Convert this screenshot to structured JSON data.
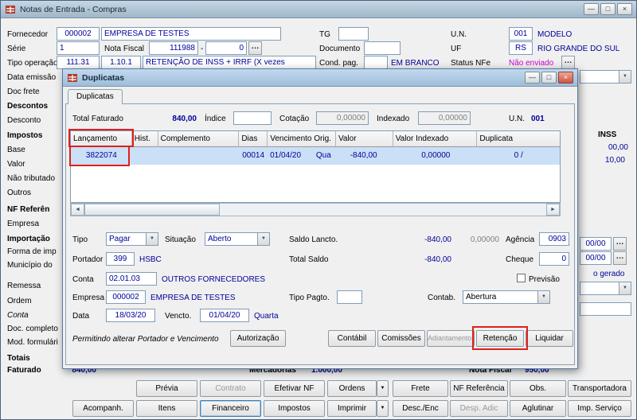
{
  "icons": {
    "minimize": "—",
    "maximize": "□",
    "close": "×",
    "dropdown": "▼",
    "dots": "…",
    "scroll_left": "◄",
    "scroll_right": "►",
    "dash": "-"
  },
  "window": {
    "title": "Notas de Entrada - Compras"
  },
  "form": {
    "fornecedor_label": "Fornecedor",
    "fornecedor_code": "000002",
    "fornecedor_name": "EMPRESA DE TESTES",
    "tg_label": "TG",
    "un_label": "U.N.",
    "un_code": "001",
    "un_name": "MODELO",
    "serie_label": "Série",
    "serie": "1",
    "nota_fiscal_label": "Nota Fiscal",
    "nota_fiscal_numero": "111988",
    "nota_fiscal_sufixo": "0",
    "documento_label": "Documento",
    "uf_label": "UF",
    "uf_code": "RS",
    "uf_name": "RIO GRANDE DO SUL",
    "tipo_operacao_label": "Tipo operação",
    "tipo_operacao_code1": "111.31",
    "tipo_operacao_code2": "1.10.1",
    "tipo_operacao_desc": "RETENÇÃO DE INSS + IRRF (X vezes",
    "cond_pag_label": "Cond. pag.",
    "cond_pag_desc": "EM BRANCO",
    "status_nfe_label": "Status NFe",
    "status_nfe": "Não enviado",
    "data_emissao_label": "Data emissão",
    "doc_frete_label": "Doc frete"
  },
  "left_labels": {
    "descontos": "Descontos",
    "desconto": "Desconto",
    "impostos": "Impostos",
    "base": "Base",
    "valor": "Valor",
    "nao_tributado": "Não tributado",
    "outros": "Outros",
    "nf_referencia": "NF Referên",
    "empresa": "Empresa",
    "importacao": "Importação",
    "forma_imp": "Forma de imp",
    "municipio": "Município do",
    "remessa": "Remessa",
    "ordem": "Ordem",
    "conta": "Conta",
    "doc_completo": "Doc. completo",
    "mod_formulario": "Mod. formulári"
  },
  "right_panel": {
    "inss_label": "INSS",
    "valor1": "00,00",
    "valor2": "10,00",
    "data1": "00/00",
    "data2": "00/00",
    "gerado": "o gerado"
  },
  "totais": {
    "label": "Totais",
    "faturado_label": "Faturado",
    "faturado": "840,00",
    "mercadorias_label": "Mercadorias",
    "mercadorias": "1.000,00",
    "nota_fiscal_label": "Nota Fiscal",
    "nota_fiscal": "950,00"
  },
  "buttons_row1": [
    {
      "label": "Prévia"
    },
    {
      "label": "Contrato"
    },
    {
      "label": "Efetivar NF"
    },
    {
      "label": "Ordens"
    },
    {
      "label": "Frete"
    },
    {
      "label": "NF Referência"
    },
    {
      "label": "Obs."
    },
    {
      "label": "Transportadora"
    }
  ],
  "buttons_row2": [
    {
      "label": "Acompanh."
    },
    {
      "label": "Itens"
    },
    {
      "label": "Financeiro"
    },
    {
      "label": "Impostos"
    },
    {
      "label": "Imprimir"
    },
    {
      "label": "Desc./Enc"
    },
    {
      "label": "Desp. Adic"
    },
    {
      "label": "Aglutinar"
    },
    {
      "label": "Imp. Serviço"
    }
  ],
  "dialog": {
    "title": "Duplicatas",
    "tab": "Duplicatas",
    "summary": {
      "total_faturado_label": "Total Faturado",
      "total_faturado": "840,00",
      "indice_label": "Índice",
      "cotacao_label": "Cotação",
      "cotacao": "0,00000",
      "indexado_label": "Indexado",
      "indexado": "0,00000",
      "un_label": "U.N.",
      "un": "001"
    },
    "grid": {
      "columns": [
        "Lançamento",
        "Hist.",
        "Complemento",
        "Dias",
        "Vencimento Orig.",
        "Valor",
        "Valor Indexado",
        "Duplicata"
      ],
      "row": {
        "lancamento": "3822074",
        "dias": "00014",
        "vencimento": "01/04/20",
        "dia_semana": "Qua",
        "valor": "-840,00",
        "valor_indexado": "0,00000",
        "duplicata": "0 /"
      }
    },
    "detail": {
      "tipo_label": "Tipo",
      "tipo": "Pagar",
      "situacao_label": "Situação",
      "situacao": "Aberto",
      "saldo_lancto_label": "Saldo Lancto.",
      "saldo_lancto": "-840,00",
      "saldo_lancto_idx": "0,00000",
      "agencia_label": "Agência",
      "agencia": "0903",
      "portador_label": "Portador",
      "portador_code": "399",
      "portador_name": "HSBC",
      "total_saldo_label": "Total Saldo",
      "total_saldo": "-840,00",
      "cheque_label": "Cheque",
      "cheque": "0",
      "conta_label": "Conta",
      "conta_code": "02.01.03",
      "conta_name": "OUTROS FORNECEDORES",
      "previsao_label": "Previsão",
      "empresa_label": "Empresa",
      "empresa_code": "000002",
      "empresa_name": "EMPRESA DE TESTES",
      "tipo_pagto_label": "Tipo Pagto.",
      "contab_label": "Contab.",
      "contab": "Abertura",
      "data_label": "Data",
      "data": "18/03/20",
      "vencto_label": "Vencto.",
      "vencto": "01/04/20",
      "vencto_dia": "Quarta",
      "permissao_text": "Permitindo alterar Portador e Vencimento",
      "autorizacao_label": "Autorização"
    },
    "buttons": [
      {
        "label": "Contábil"
      },
      {
        "label": "Comissões"
      },
      {
        "label": "Adiantamentos"
      },
      {
        "label": "Retenção"
      },
      {
        "label": "Liquidar"
      }
    ]
  }
}
